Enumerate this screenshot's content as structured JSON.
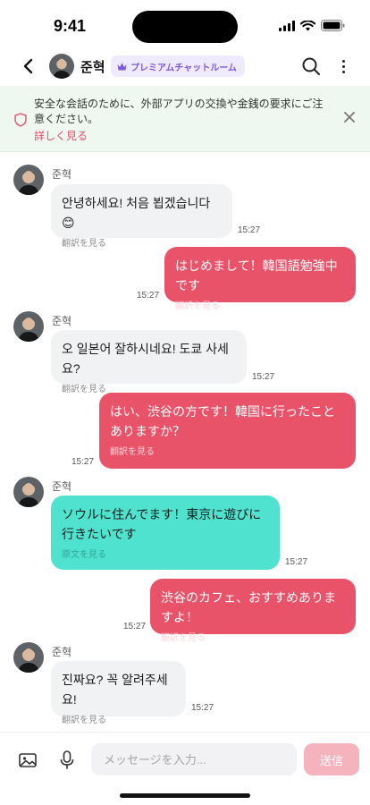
{
  "status_bar": {
    "time": "9:41"
  },
  "header": {
    "contact_name": "준혁",
    "premium_label": "プレミアムチャットルーム",
    "icons": {
      "back": "chevron-left-icon",
      "search": "search-icon",
      "more": "more-vertical-icon",
      "crown": "crown-icon"
    }
  },
  "notice": {
    "text": "安全な会話のために、外部アプリの交換や金銭の要求にご注意ください。",
    "link_label": "詳しく見る",
    "icons": {
      "shield": "shield-icon",
      "close": "close-icon"
    }
  },
  "messages": [
    {
      "sender": "준혁",
      "direction": "in",
      "text": "안녕하세요! 처음 뵙겠습니다 😊",
      "action": "翻訳を見る",
      "time": "15:27"
    },
    {
      "sender": "",
      "direction": "out",
      "text": "はじめまして！韓国語勉強中です",
      "action": "翻訳を見る",
      "time": "15:27"
    },
    {
      "sender": "준혁",
      "direction": "in",
      "text": "오 일본어 잘하시네요! 도쿄 사세요?",
      "action": "翻訳を見る",
      "time": "15:27"
    },
    {
      "sender": "",
      "direction": "out",
      "text": "はい、渋谷の方です！韓国に行ったことありますか？",
      "action": "翻訳を見る",
      "time": "15:27"
    },
    {
      "sender": "준혁",
      "direction": "in",
      "text": "ソウルに住んでます！東京に遊びに行きたいです",
      "action": "原文を見る",
      "time": "15:27"
    },
    {
      "sender": "",
      "direction": "out",
      "text": "渋谷のカフェ、おすすめありますよ！",
      "action": "翻訳を見る",
      "time": "15:27"
    },
    {
      "sender": "준혁",
      "direction": "in",
      "text": "진짜요? 꼭 알려주세요!",
      "action": "翻訳を見る",
      "time": "15:27"
    }
  ],
  "input": {
    "placeholder": "メッセージを入力...",
    "value": "",
    "send_label": "送信",
    "icons": {
      "image": "image-icon",
      "mic": "microphone-icon"
    }
  },
  "colors": {
    "outgoing_bubble": "#e8536a",
    "incoming_bubble": "#f1f2f4",
    "highlight_bubble": "#4fe3cf",
    "notice_bg": "#eef8f1",
    "premium_badge": "#efeafd",
    "send_button": "#f5b3bd"
  }
}
